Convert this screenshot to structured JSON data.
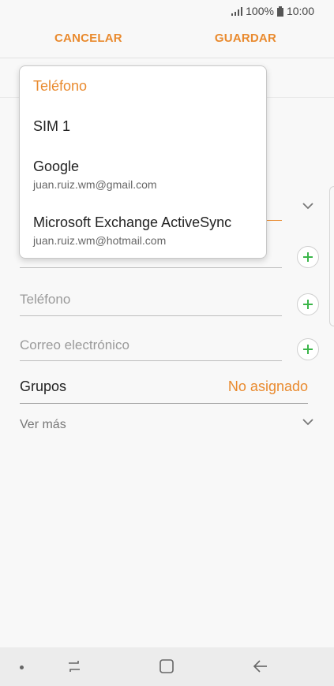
{
  "status_bar": {
    "battery": "100%",
    "time": "10:00"
  },
  "action_bar": {
    "cancel_label": "CANCELAR",
    "save_label": "GUARDAR"
  },
  "dropdown": {
    "title": "Teléfono",
    "items": [
      {
        "name": "SIM 1",
        "account": ""
      },
      {
        "name": "Google",
        "account": "juan.ruiz.wm@gmail.com"
      },
      {
        "name": "Microsoft Exchange ActiveSync",
        "account": "juan.ruiz.wm@hotmail.com"
      }
    ]
  },
  "fields": {
    "phone_placeholder": "Teléfono",
    "email_placeholder": "Correo electrónico"
  },
  "groups": {
    "label": "Grupos",
    "value": "No asignado"
  },
  "more": {
    "label": "Ver más"
  },
  "colors": {
    "accent": "#e98a2e",
    "plus": "#3bb64a"
  },
  "icons": [
    "signal-icon",
    "battery-icon",
    "chevron-down-icon",
    "plus-icon",
    "recents-icon",
    "home-icon",
    "back-icon"
  ]
}
